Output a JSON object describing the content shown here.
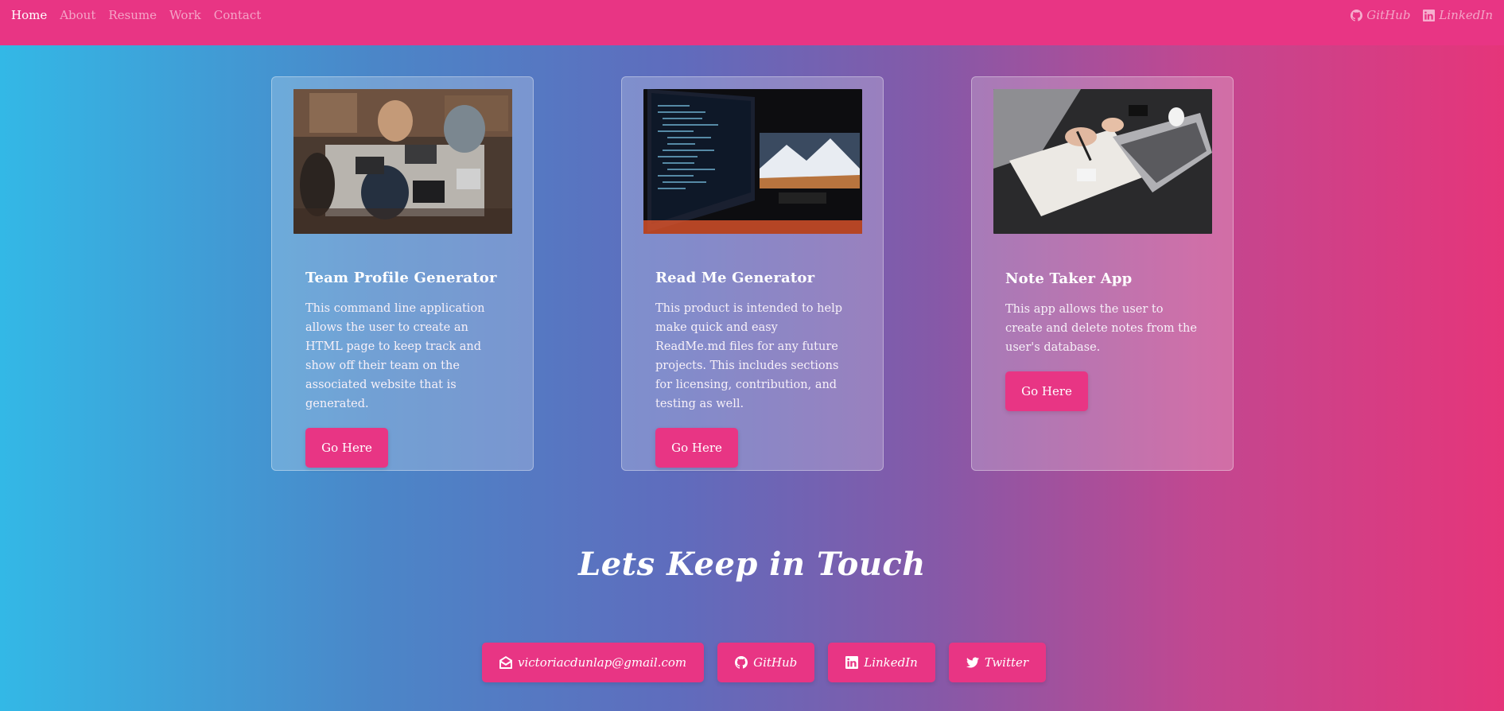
{
  "nav": {
    "links": [
      "Home",
      "About",
      "Resume",
      "Work",
      "Contact"
    ],
    "social": [
      {
        "label": "GitHub",
        "icon": "github-icon"
      },
      {
        "label": "LinkedIn",
        "icon": "linkedin-icon"
      }
    ]
  },
  "projects": [
    {
      "title": "Team Profile Generator",
      "description": "This command line application allows the user to create an HTML page to keep track and show off their team on the associated website that is generated.",
      "button": "Go Here",
      "image": "team-meeting-photo"
    },
    {
      "title": "Read Me Generator",
      "description": "This product is intended to help make quick and easy ReadMe.md files for any future projects. This includes sections for licensing, contribution, and testing as well.",
      "button": "Go Here",
      "image": "code-monitors-photo"
    },
    {
      "title": "Note Taker App",
      "description": "This app allows the user to create and delete notes from the user's database.",
      "button": "Go Here",
      "image": "notebook-laptop-photo"
    }
  ],
  "contact": {
    "heading": "Lets Keep in Touch",
    "email": "victoriacdunlap@gmail.com",
    "github": "GitHub",
    "linkedin": "LinkedIn",
    "twitter": "Twitter"
  },
  "colors": {
    "accent": "#e83584",
    "gradient_start": "#33b8e6",
    "gradient_end": "#e5357a"
  }
}
